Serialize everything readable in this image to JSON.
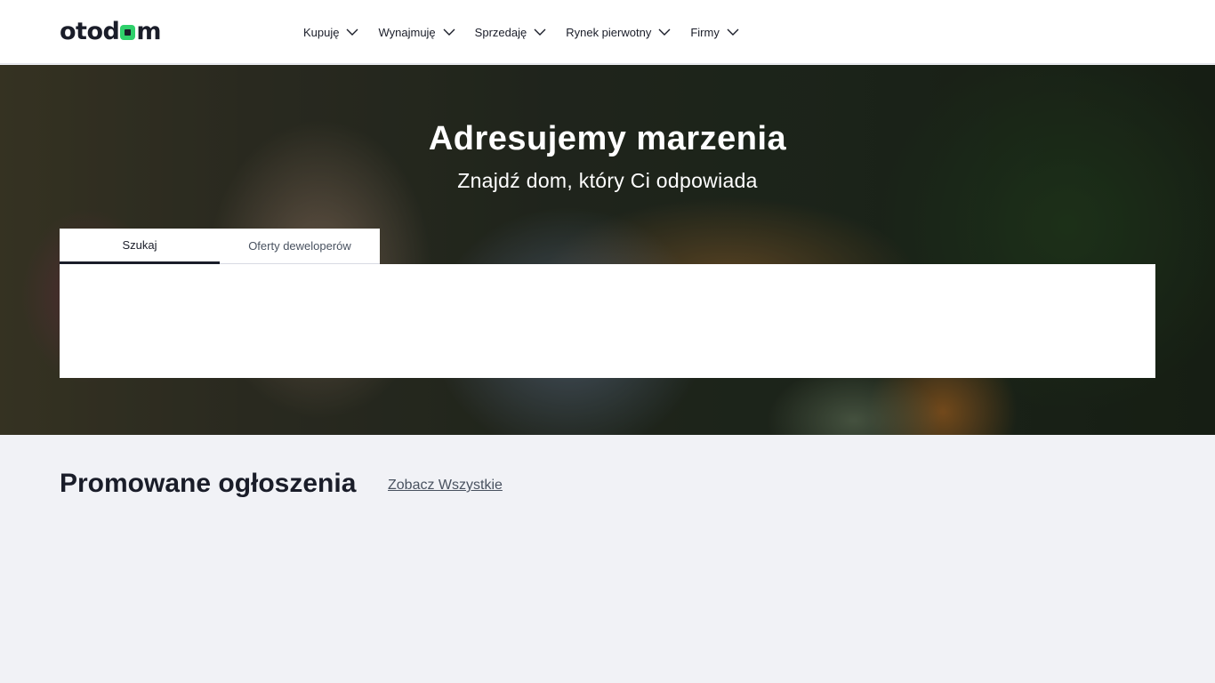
{
  "header": {
    "logo_text": "otodom",
    "nav": [
      {
        "label": "Kupuję"
      },
      {
        "label": "Wynajmuję"
      },
      {
        "label": "Sprzedaję"
      },
      {
        "label": "Rynek pierwotny"
      },
      {
        "label": "Firmy"
      }
    ]
  },
  "hero": {
    "title": "Adresujemy marzenia",
    "subtitle": "Znajdź dom, który Ci odpowiada"
  },
  "search": {
    "tabs": [
      {
        "label": "Szukaj",
        "active": true
      },
      {
        "label": "Oferty deweloperów",
        "active": false
      }
    ]
  },
  "promoted": {
    "title": "Promowane ogłoszenia",
    "see_all": "Zobacz Wszystkie"
  },
  "colors": {
    "brand_green": "#2fd06b",
    "text_dark": "#1a1d29",
    "page_bg": "#f1f2f6"
  }
}
